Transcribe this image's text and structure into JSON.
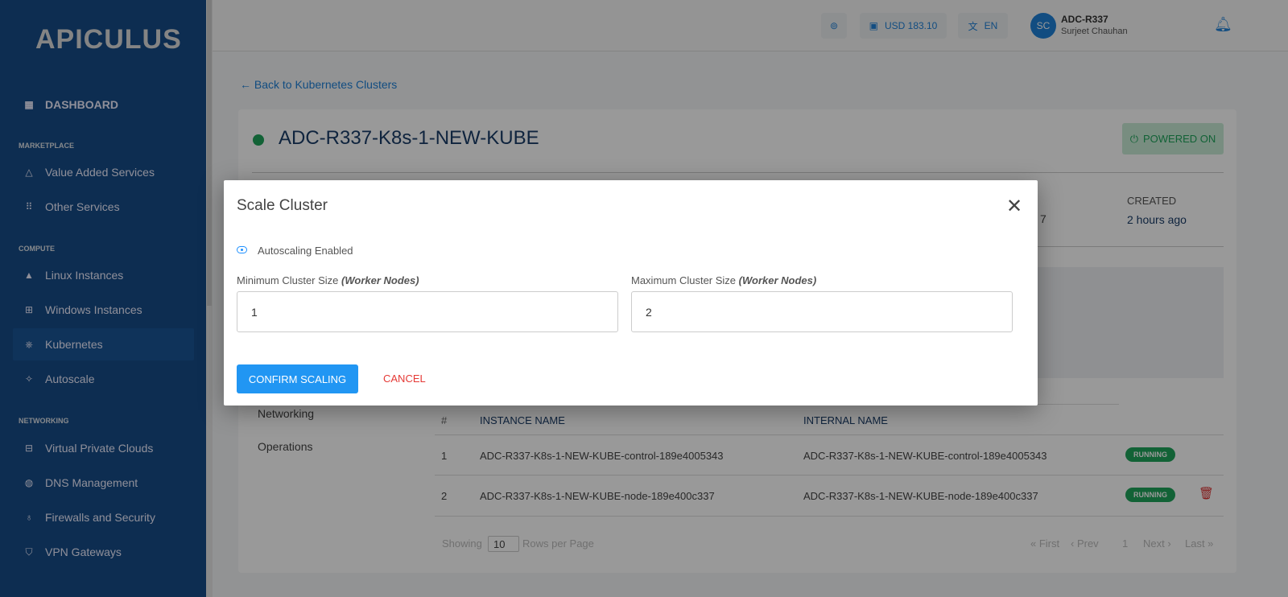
{
  "brand": "APICULUS",
  "sidebar": {
    "dashboard": "DASHBOARD",
    "sections": {
      "marketplace": "MARKETPLACE",
      "compute": "COMPUTE",
      "networking": "NETWORKING"
    },
    "items": [
      {
        "label": "Value Added Services",
        "icon": "shapes-icon"
      },
      {
        "label": "Other Services",
        "icon": "grid-icon"
      },
      {
        "label": "Linux Instances",
        "icon": "linux-icon"
      },
      {
        "label": "Windows Instances",
        "icon": "windows-icon"
      },
      {
        "label": "Kubernetes",
        "icon": "kubernetes-icon",
        "active": true
      },
      {
        "label": "Autoscale",
        "icon": "magic-wand-icon"
      },
      {
        "label": "Virtual Private Clouds",
        "icon": "network-icon"
      },
      {
        "label": "DNS Management",
        "icon": "globe-icon"
      },
      {
        "label": "Firewalls and Security",
        "icon": "firewall-icon"
      },
      {
        "label": "VPN Gateways",
        "icon": "shield-icon"
      }
    ]
  },
  "header": {
    "balance": "USD 183.10",
    "language": "EN",
    "avatar": "SC",
    "account": "ADC-R337",
    "user": "Surjeet Chauhan"
  },
  "page": {
    "back": "Back to Kubernetes Clusters",
    "cluster_name": "ADC-R337-K8s-1-NEW-KUBE",
    "status": "POWERED ON",
    "created_label": "CREATED",
    "created_value": "2 hours ago",
    "partial_value": "7",
    "tabs": [
      "Networking",
      "Operations"
    ],
    "table": {
      "headers": [
        "#",
        "INSTANCE NAME",
        "INTERNAL NAME"
      ],
      "rows": [
        {
          "n": "1",
          "instance": "ADC-R337-K8s-1-NEW-KUBE-control-189e4005343",
          "internal": "ADC-R337-K8s-1-NEW-KUBE-control-189e4005343",
          "status": "RUNNING"
        },
        {
          "n": "2",
          "instance": "ADC-R337-K8s-1-NEW-KUBE-node-189e400c337",
          "internal": "ADC-R337-K8s-1-NEW-KUBE-node-189e400c337",
          "status": "RUNNING"
        }
      ]
    },
    "pagination": {
      "showing": "Showing",
      "rows": "10",
      "per_page": "Rows per Page",
      "first": "« First",
      "prev": "‹ Prev",
      "page": "1",
      "next": "Next ›",
      "last": "Last »"
    }
  },
  "modal": {
    "title": "Scale Cluster",
    "autoscaling": "Autoscaling Enabled",
    "min_label": "Minimum Cluster Size",
    "max_label": "Maximum Cluster Size",
    "nodes_hint": "(Worker Nodes)",
    "min_value": "1",
    "max_value": "2",
    "confirm": "CONFIRM SCALING",
    "cancel": "CANCEL"
  },
  "colors": {
    "primary": "#2196f3",
    "sidebar": "#164c88",
    "success": "#1ea35a",
    "danger": "#e53935"
  }
}
